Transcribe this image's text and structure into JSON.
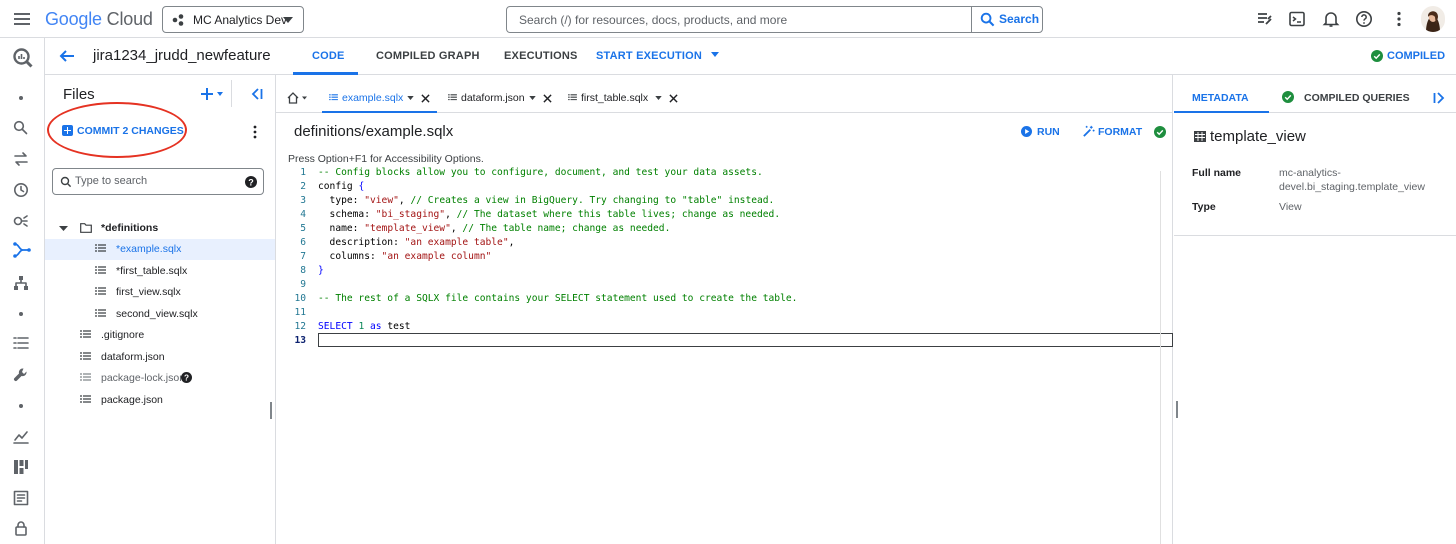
{
  "header": {
    "logo_google": "Google",
    "logo_cloud": "Cloud",
    "project_name": "MC Analytics Dev",
    "search_placeholder": "Search (/) for resources, docs, products, and more",
    "search_button": "Search"
  },
  "subheader": {
    "workspace_name": "jira1234_jrudd_newfeature",
    "tabs": [
      {
        "label": "CODE",
        "active": true
      },
      {
        "label": "COMPILED GRAPH",
        "active": false
      },
      {
        "label": "EXECUTIONS",
        "active": false
      },
      {
        "label": "START EXECUTION",
        "active": false
      }
    ],
    "compiled_status": "COMPILED"
  },
  "files": {
    "title": "Files",
    "commit_label": "COMMIT 2 CHANGES",
    "search_placeholder": "Type to search",
    "tree": [
      {
        "name": "*definitions",
        "type": "folder",
        "bold": true
      },
      {
        "name": "*example.sqlx",
        "type": "file",
        "selected": true
      },
      {
        "name": "*first_table.sqlx",
        "type": "file"
      },
      {
        "name": "first_view.sqlx",
        "type": "file"
      },
      {
        "name": "second_view.sqlx",
        "type": "file"
      },
      {
        "name": ".gitignore",
        "type": "file"
      },
      {
        "name": "dataform.json",
        "type": "file"
      },
      {
        "name": "package-lock.json",
        "type": "file",
        "dimmed": true
      },
      {
        "name": "package.json",
        "type": "file"
      }
    ]
  },
  "editor": {
    "tabs": [
      {
        "label": "example.sqlx",
        "active": true
      },
      {
        "label": "dataform.json",
        "active": false
      },
      {
        "label": "first_table.sqlx",
        "active": false
      }
    ],
    "file_title": "definitions/example.sqlx",
    "run_label": "RUN",
    "format_label": "FORMAT",
    "accessibility_hint": "Press Option+F1 for Accessibility Options.",
    "code_lines": [
      "-- Config blocks allow you to configure, document, and test your data assets.",
      "config {",
      "  type: \"view\", // Creates a view in BigQuery. Try changing to \"table\" instead.",
      "  schema: \"bi_staging\", // The dataset where this table lives; change as needed.",
      "  name: \"template_view\", // The table name; change as needed.",
      "  description: \"an example table\",",
      "  columns: \"an example column\"",
      "}",
      "",
      "-- The rest of a SQLX file contains your SELECT statement used to create the table.",
      "",
      "SELECT 1 as test",
      ""
    ],
    "current_line": 13
  },
  "right_panel": {
    "tabs": [
      {
        "label": "METADATA",
        "active": true
      },
      {
        "label": "COMPILED QUERIES",
        "active": false
      }
    ],
    "title": "template_view",
    "rows": [
      {
        "key": "Full name",
        "value": "mc-analytics-devel.bi_staging.template_view"
      },
      {
        "key": "Type",
        "value": "View"
      }
    ]
  },
  "colors": {
    "accent": "#1a73e8",
    "success": "#1e8e3e",
    "annotation": "#e53222",
    "comment": "#008000",
    "string": "#a31515",
    "keyword": "#0000ff"
  }
}
